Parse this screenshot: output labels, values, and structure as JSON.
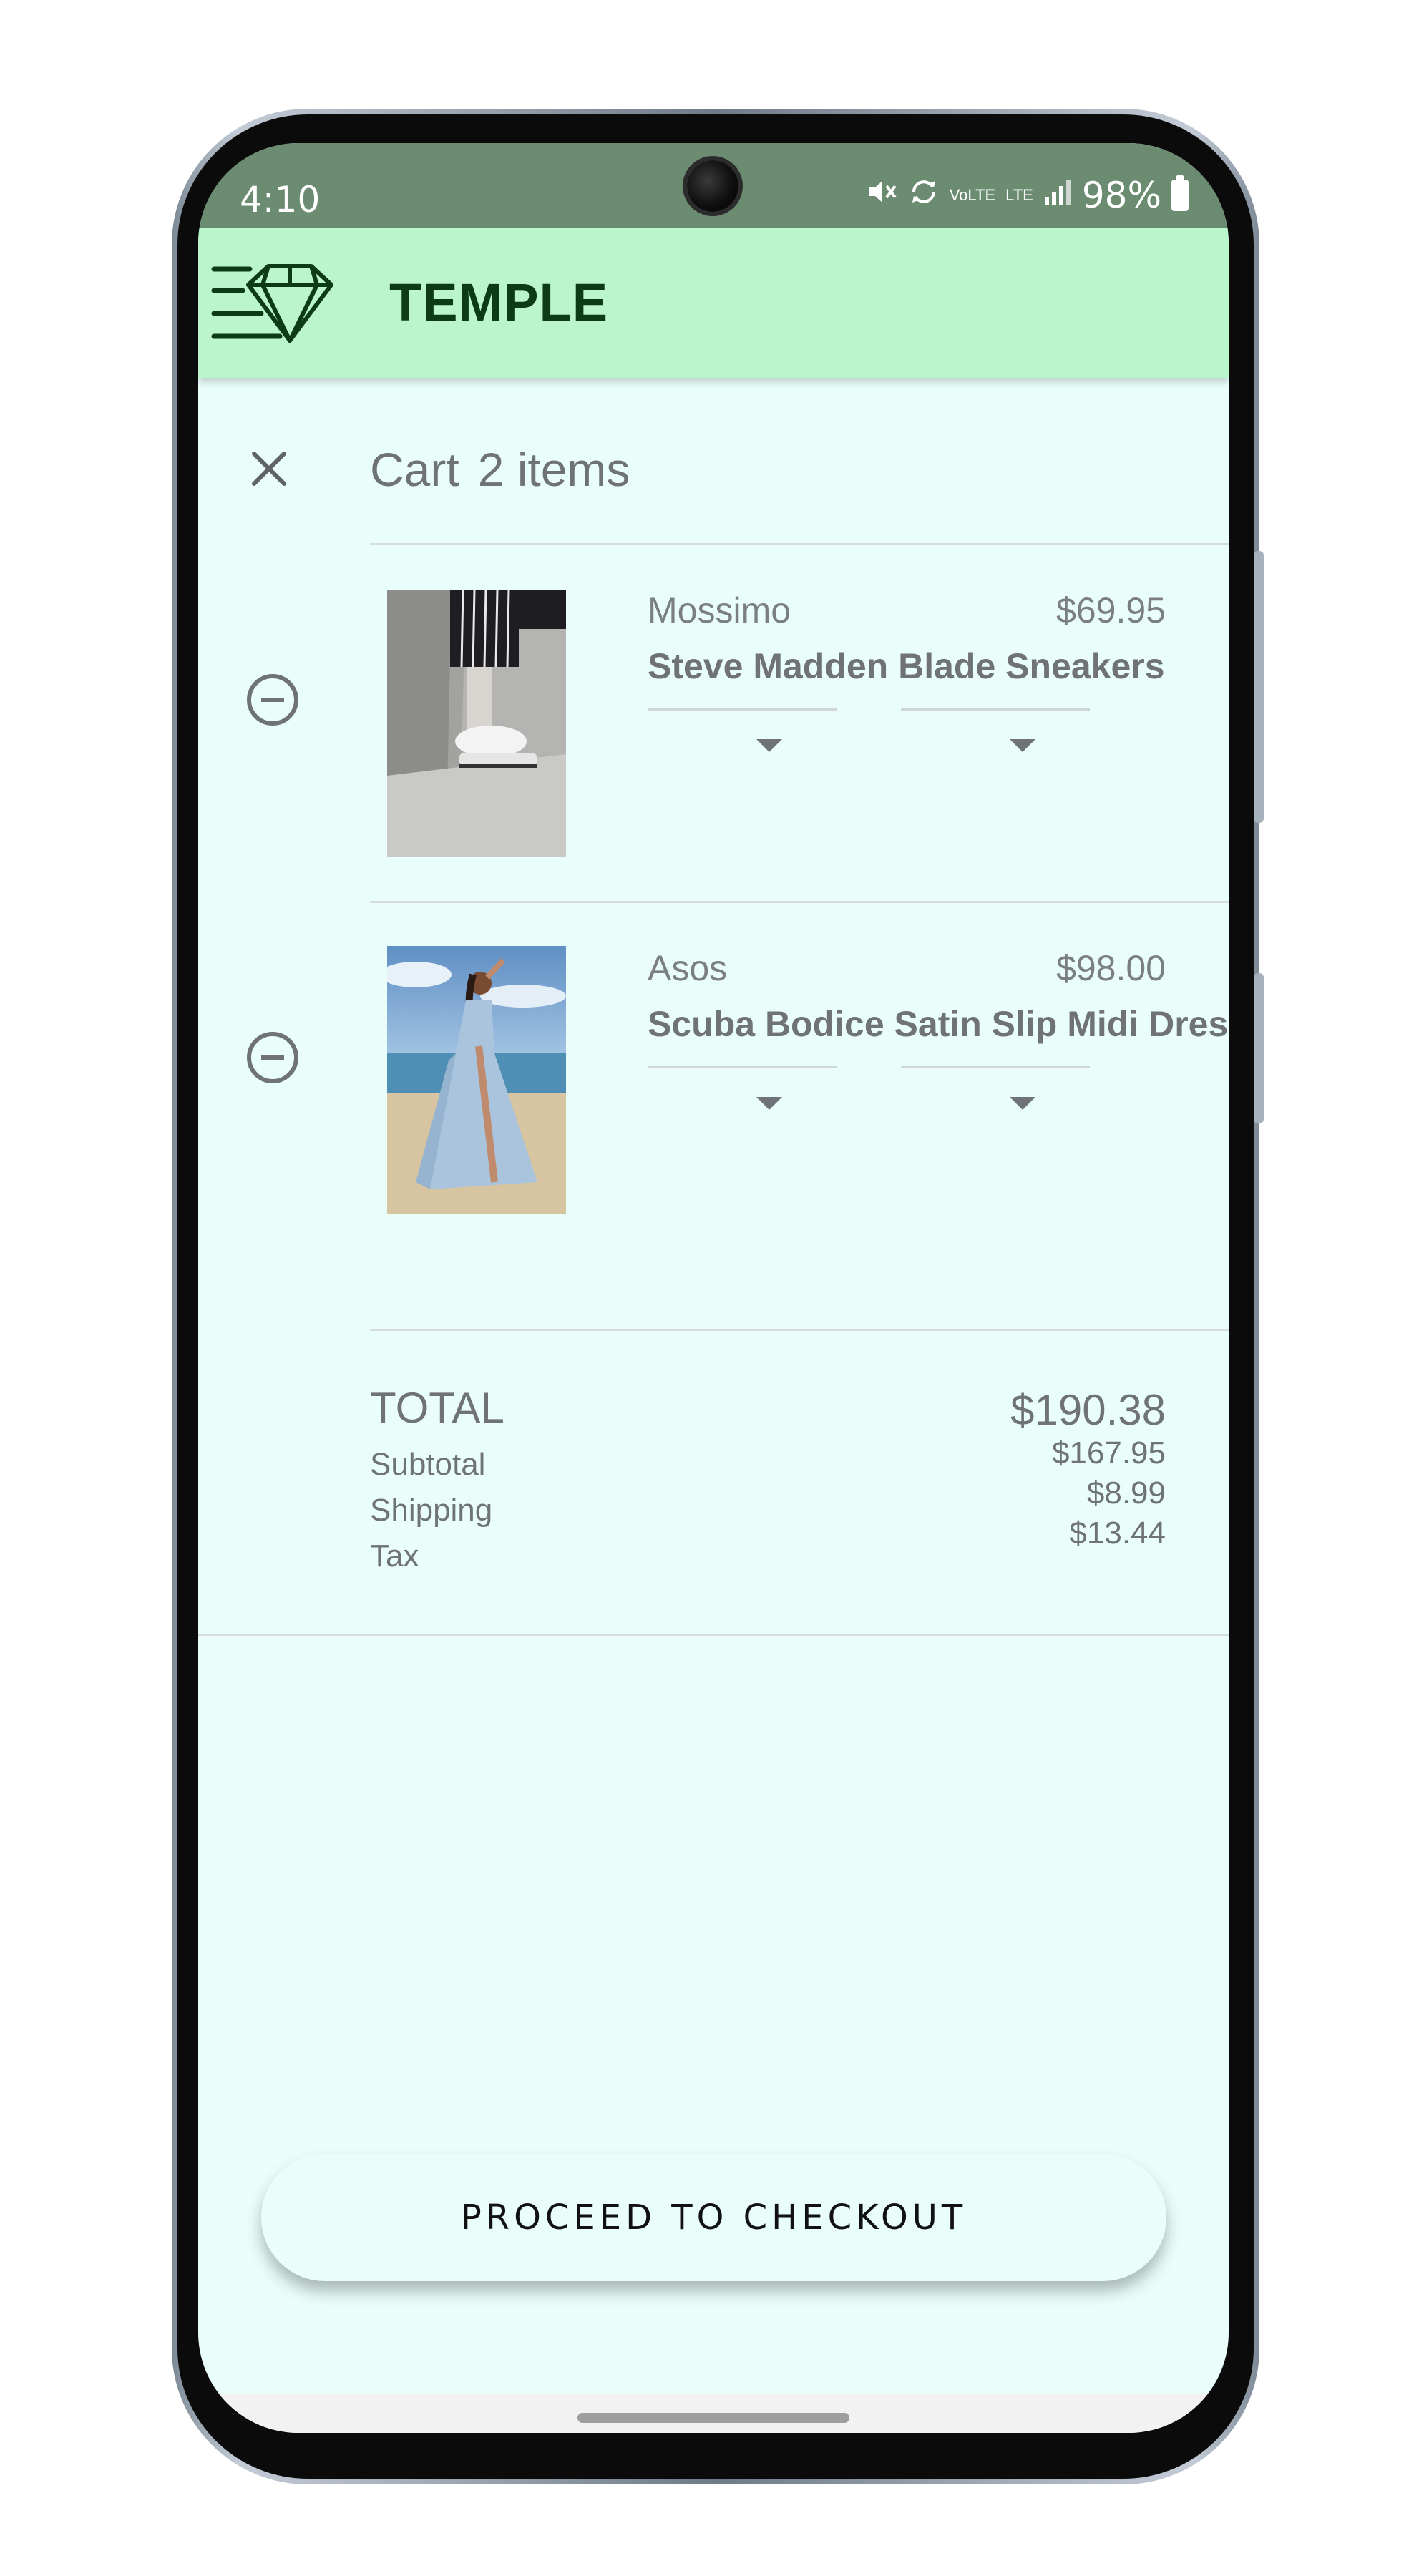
{
  "status_bar": {
    "time": "4:10",
    "volte": "VoLTE",
    "lte": "LTE",
    "battery": "98%"
  },
  "appbar": {
    "title": "TEMPLE",
    "logo": "diamond-menu-icon"
  },
  "cart": {
    "title": "Cart",
    "count": "2 items",
    "items": [
      {
        "brand": "Mossimo",
        "price": "$69.95",
        "name": "Steve Madden Blade Sneakers",
        "image": "sneakers-photo"
      },
      {
        "brand": "Asos",
        "price": "$98.00",
        "name": "Scuba Bodice Satin Slip Midi Dress",
        "image": "dress-photo"
      }
    ]
  },
  "summary": {
    "total_label": "TOTAL",
    "total_value": "$190.38",
    "subtotal_label": "Subtotal",
    "subtotal_value": "$167.95",
    "shipping_label": "Shipping",
    "shipping_value": "$8.99",
    "tax_label": "Tax",
    "tax_value": "$13.44"
  },
  "checkout": {
    "label": "PROCEED TO CHECKOUT"
  },
  "colors": {
    "status_bar": "#6c8c72",
    "appbar": "#bbf5cb",
    "screen_bg": "#e9fefb",
    "title_text": "#0d3b14"
  }
}
